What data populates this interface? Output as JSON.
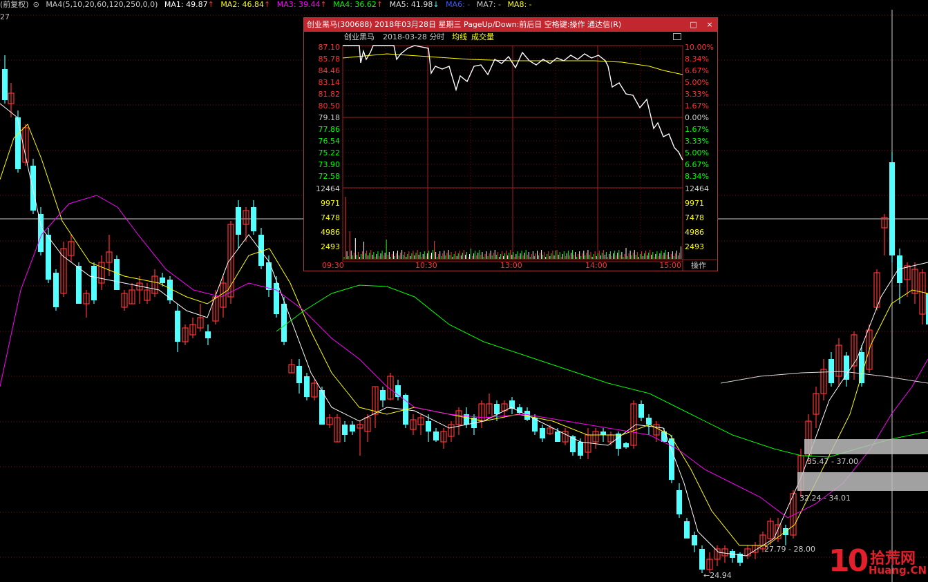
{
  "ma_bar": {
    "prefix": "(前复权)",
    "ma4_def": "MA4(5,10,20,60,120,250,0,0)",
    "ma1": "MA1: 49.87",
    "ma1_arrow": "↑",
    "ma2": "MA2: 46.84",
    "ma2_arrow": "↑",
    "ma3": "MA3: 39.44",
    "ma3_arrow": "↑",
    "ma4": "MA4: 36.62",
    "ma4_arrow": "↑",
    "ma5": "MA5: 41.98",
    "ma5_arrow": "↓",
    "ma6": "MA6: -",
    "ma7": "MA7: -",
    "ma8": "MA8: -"
  },
  "main_chart": {
    "top_price_label": "27",
    "annotations": {
      "zone_high": "35.47 - 37.00",
      "zone_low": "32.24 - 34.01",
      "gap_bottom": "27.79 - 28.00",
      "low_price": "←24.94"
    }
  },
  "popup": {
    "title": "创业黑马(300688) 2018年03月28日 星期三 PageUp/Down:前后日 空格键:操作 通达信(R)",
    "minimize": "□",
    "close": "×",
    "stock_name": "创业黑马",
    "date": "2018-03-28 分时",
    "avg_label": "均线",
    "vol_label": "成交量",
    "price_labels": [
      "87.10",
      "85.78",
      "84.46",
      "83.14",
      "81.82",
      "80.50",
      "79.18",
      "77.86",
      "76.54",
      "75.22",
      "73.90",
      "72.58"
    ],
    "pct_labels": [
      "10.00%",
      "8.34%",
      "6.67%",
      "5.00%",
      "3.33%",
      "1.67%",
      "0.00%",
      "1.67%",
      "3.33%",
      "5.00%",
      "6.67%",
      "8.34%"
    ],
    "vol_labels": [
      "12464",
      "9971",
      "7478",
      "4986",
      "2493"
    ],
    "time_labels": [
      "09:30",
      "10:30",
      "13:00",
      "14:00",
      "15:00"
    ],
    "operate": "操作"
  },
  "colors": {
    "up": "#ff3232",
    "down": "#54ffff",
    "ma1": "#ffffff",
    "ma2": "#ffff00",
    "ma3": "#ff00ff",
    "ma4": "#00ff00",
    "ma5": "#dddddd",
    "ma6": "#0000ff"
  },
  "logo": {
    "number": "10",
    "cn": "拾荒网",
    "en": "Huang.CN"
  }
}
